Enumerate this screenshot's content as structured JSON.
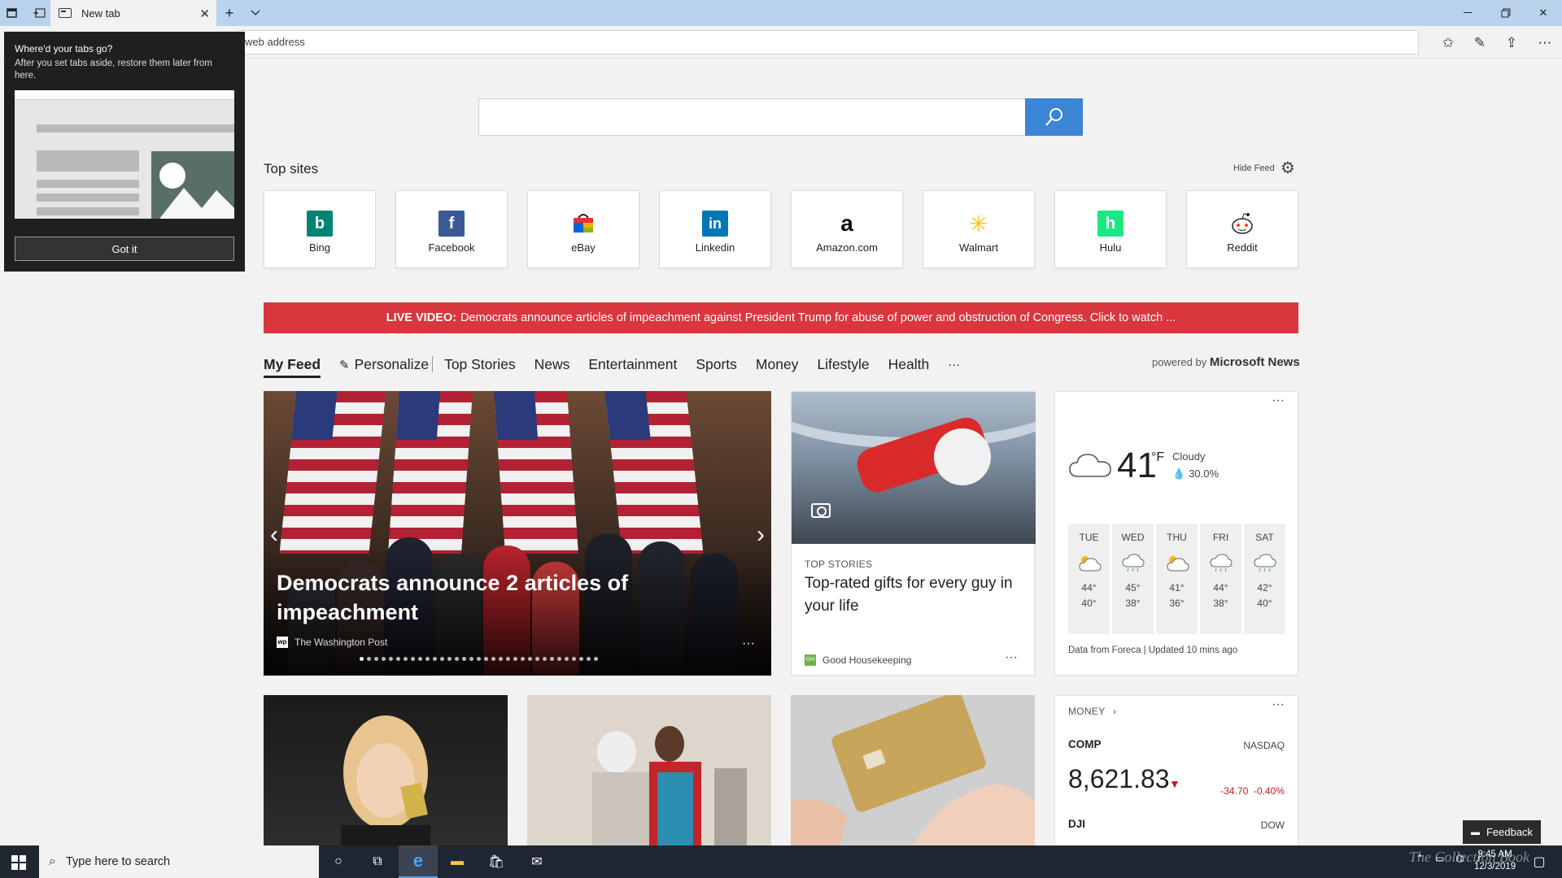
{
  "tab": {
    "title": "New tab"
  },
  "address": {
    "placeholder": "web address"
  },
  "popup": {
    "title": "Where'd your tabs go?",
    "body": "After you set tabs aside, restore them later from here.",
    "button": "Got it"
  },
  "top_sites": {
    "title": "Top sites",
    "hide_feed": "Hide Feed",
    "sites": [
      {
        "name": "Bing",
        "color": "#008373",
        "glyph": "b"
      },
      {
        "name": "Facebook",
        "color": "#3b5998",
        "glyph": "f"
      },
      {
        "name": "eBay",
        "color": "#222222",
        "glyph": "🛍"
      },
      {
        "name": "Linkedin",
        "color": "#0077b5",
        "glyph": "in"
      },
      {
        "name": "Amazon.com",
        "color": "#ffffff",
        "glyph": "a"
      },
      {
        "name": "Walmart",
        "color": "#ffffff",
        "glyph": "✳"
      },
      {
        "name": "Hulu",
        "color": "#1ce783",
        "glyph": "h"
      },
      {
        "name": "Reddit",
        "color": "#ffffff",
        "glyph": "◉"
      }
    ]
  },
  "live_banner": {
    "label": "LIVE VIDEO:",
    "text": "Democrats announce articles of impeachment against President Trump for abuse of power and obstruction of Congress. Click to watch ..."
  },
  "feed_nav": {
    "items": [
      "My Feed",
      "Personalize",
      "Top Stories",
      "News",
      "Entertainment",
      "Sports",
      "Money",
      "Lifestyle",
      "Health",
      "···"
    ],
    "powered_by_prefix": "powered by",
    "powered_by": "Microsoft News"
  },
  "hero": {
    "headline": "Democrats announce 2 articles of impeachment",
    "source": "The Washington Post",
    "source_logo": "wp",
    "slide_count": 33,
    "current_slide": 1
  },
  "story": {
    "kicker": "TOP STORIES",
    "title": "Top-rated gifts for every guy in your life",
    "source": "Good Housekeeping",
    "source_logo": "GH"
  },
  "weather": {
    "temp": "41",
    "unit": "°F",
    "condition": "Cloudy",
    "precip": "30.0%",
    "forecast": [
      {
        "day": "TUE",
        "hi": "44°",
        "lo": "40°",
        "icon": "partly-sunny"
      },
      {
        "day": "WED",
        "hi": "45°",
        "lo": "38°",
        "icon": "rain"
      },
      {
        "day": "THU",
        "hi": "41°",
        "lo": "36°",
        "icon": "partly-sunny"
      },
      {
        "day": "FRI",
        "hi": "44°",
        "lo": "38°",
        "icon": "rain"
      },
      {
        "day": "SAT",
        "hi": "42°",
        "lo": "40°",
        "icon": "rain"
      }
    ],
    "footer": "Data from Foreca | Updated 10 mins ago"
  },
  "money": {
    "header": "MONEY",
    "symbol": "COMP",
    "exchange": "NASDAQ",
    "price": "8,621.83",
    "change": "-34.70",
    "change_pct": "-0.40%",
    "symbol2": "DJI",
    "exchange2": "DOW"
  },
  "feedback": {
    "label": "Feedback"
  },
  "taskbar": {
    "search_placeholder": "Type here to search",
    "time": "9:45 AM",
    "date": "12/3/2019"
  },
  "watermark": "The Collection Book"
}
